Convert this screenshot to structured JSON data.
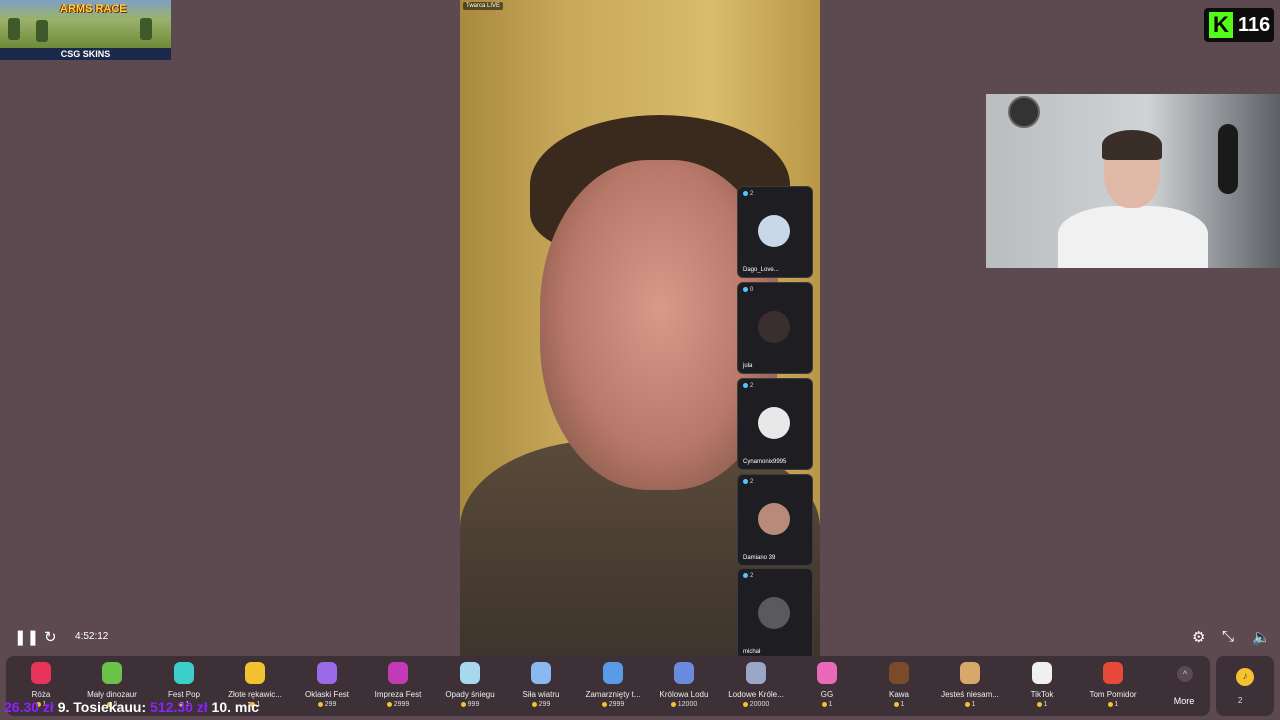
{
  "banner": {
    "title": "ARMS RACE",
    "sponsor": "CSG SKINS"
  },
  "kick": {
    "logo": "K",
    "viewers": "116"
  },
  "main_video": {
    "tag": "Twarca LIVE"
  },
  "guests": [
    {
      "count": "2",
      "name": "Dago_Love..."
    },
    {
      "count": "0",
      "name": "jula"
    },
    {
      "count": "2",
      "name": "Cynamonix9995"
    },
    {
      "count": "2",
      "name": "Damiano 39"
    },
    {
      "count": "2",
      "name": "michał"
    }
  ],
  "player": {
    "time": "4:52:12"
  },
  "gifts": [
    {
      "label": "Róża",
      "price": "1",
      "color": "#e8335a"
    },
    {
      "label": "Mały dinozaur",
      "price": "5",
      "color": "#6cc14a"
    },
    {
      "label": "Fest Pop",
      "price": "1",
      "color": "#3ad0c8"
    },
    {
      "label": "Złote rękawic...",
      "price": "1",
      "color": "#f2c230"
    },
    {
      "label": "Oklaski Fest",
      "price": "299",
      "color": "#9a6ae8"
    },
    {
      "label": "Impreza Fest",
      "price": "2999",
      "color": "#c23ab8"
    },
    {
      "label": "Opady śniegu",
      "price": "999",
      "color": "#a8d8f0"
    },
    {
      "label": "Siła wiatru",
      "price": "299",
      "color": "#8ab8f0"
    },
    {
      "label": "Zamarznięty t...",
      "price": "2999",
      "color": "#5a9ae8"
    },
    {
      "label": "Królowa Lodu",
      "price": "12000",
      "color": "#6a8ae0"
    },
    {
      "label": "Lodowe Króle...",
      "price": "20000",
      "color": "#9aa8c8"
    },
    {
      "label": "GG",
      "price": "1",
      "color": "#e86ab8"
    },
    {
      "label": "Kawa",
      "price": "1",
      "color": "#7a4a2a"
    },
    {
      "label": "Jesteś niesam...",
      "price": "1",
      "color": "#d8a86a"
    },
    {
      "label": "TikTok",
      "price": "1",
      "color": "#f0f0f0"
    },
    {
      "label": "Tom Pomidor",
      "price": "1",
      "color": "#e84a3a"
    }
  ],
  "more_label": "More",
  "coins": {
    "count": "2"
  },
  "ticker": {
    "amount1": "26.30 zł",
    "entry9": "9. Tosiekauu:",
    "amount9": "512.30 zł",
    "entry10": "10. mic"
  }
}
